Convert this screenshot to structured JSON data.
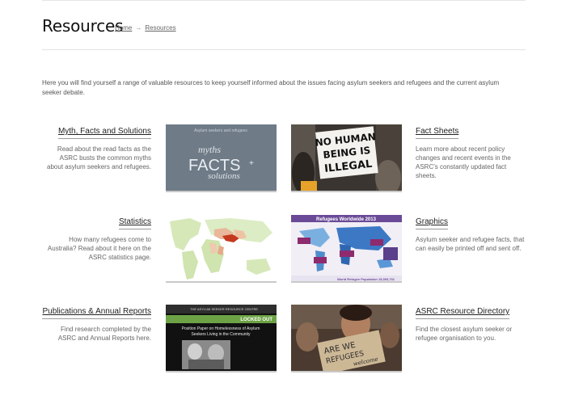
{
  "page": {
    "title": "Resources",
    "breadcrumb": {
      "home": "Home",
      "separator": "→",
      "current": "Resources"
    },
    "intro": "Here you will find yourself a range of valuable resources to keep yourself informed about the issues facing asylum seekers and refugees and the current asylum seeker debate."
  },
  "resources": [
    {
      "title": "Myth, Facts and Solutions",
      "description": "Read about the read facts as the ASRC busts the common myths about asylum seekers and refugees.",
      "image_text": {
        "top": "Asylum seekers and refugees",
        "line1": "myths",
        "line2": "FACTS",
        "plus": "+",
        "line3": "solutions"
      }
    },
    {
      "title": "Fact Sheets",
      "description": "Learn more about recent policy changes and recent events in the ASRC's constantly updated fact sheets.",
      "image_text": {
        "sign1": "NO HUMAN",
        "sign2": "BEING IS",
        "sign3": "ILLEGAL"
      }
    },
    {
      "title": "Statistics",
      "description": "How many refugees come to Australia? Read about it here on the ASRC statistics page."
    },
    {
      "title": "Graphics",
      "description": "Asylum seeker and refugee facts, that can easily be printed off and sent off.",
      "image_text": {
        "header": "Refugees Worldwide 2013",
        "footer": "World Refugee Population 15,393,731"
      }
    },
    {
      "title": "Publications & Annual Reports",
      "description": "Find research completed by the ASRC and Annual Reports here.",
      "image_text": {
        "org": "THE ASYLUM SEEKER RESOURCE CENTRE",
        "banner": "LOCKED OUT",
        "line1": "Position Paper on Homelessness of Asylum",
        "line2": "Seekers Living in the Community"
      }
    },
    {
      "title": "ASRC Resource Directory",
      "description": "Find the closest asylum seeker or refugee organisation to you.",
      "image_text": {
        "sign1": "ARE WE",
        "sign2": "REFUGEES",
        "sign3": "welcome"
      }
    }
  ],
  "colors": {
    "title": "#111111",
    "text": "#555555",
    "rule": "#e3e3e3",
    "thumb_border": "#c9c9c9"
  }
}
